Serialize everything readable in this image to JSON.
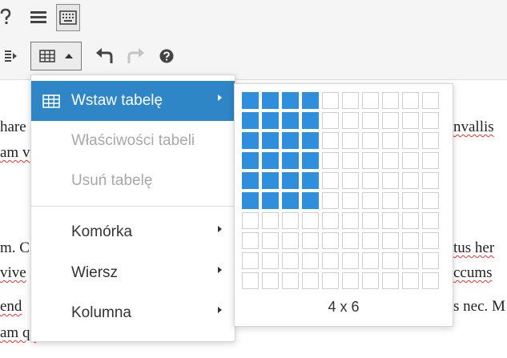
{
  "toolbar": {
    "row1": [
      {
        "name": "help-partial-icon"
      },
      {
        "name": "align-justify-icon"
      },
      {
        "name": "keyboard-icon"
      }
    ],
    "row2": [
      {
        "name": "indent-icon"
      },
      {
        "name": "table-dropdown-button"
      },
      {
        "name": "undo-icon"
      },
      {
        "name": "redo-icon"
      },
      {
        "name": "help-icon"
      }
    ]
  },
  "editor": {
    "fragments": [
      {
        "text": "hare",
        "spell": false
      },
      {
        "text": "am v",
        "spell": true
      },
      {
        "text": "nvallis",
        "spell": true
      },
      {
        "text": "m. C",
        "spell": false
      },
      {
        "text": "tus her",
        "spell": true
      },
      {
        "text": "vive",
        "spell": true
      },
      {
        "text": "ccums",
        "spell": true
      },
      {
        "text": "end",
        "spell": true
      },
      {
        "text": "s nec. M",
        "spell": false
      },
      {
        "text": "am qu",
        "spell": true
      }
    ]
  },
  "menu": {
    "items": [
      {
        "label": "Wstaw tabelę",
        "icon": "table-icon",
        "state": "active",
        "submenu": true
      },
      {
        "label": "Właściwości tabeli",
        "state": "disabled",
        "submenu": false
      },
      {
        "label": "Usuń tabelę",
        "state": "disabled",
        "submenu": false
      },
      {
        "label": "Komórka",
        "state": "normal",
        "submenu": true
      },
      {
        "label": "Wiersz",
        "state": "normal",
        "submenu": true
      },
      {
        "label": "Kolumna",
        "state": "normal",
        "submenu": true
      }
    ]
  },
  "table_grid": {
    "columns": 10,
    "rows": 10,
    "selected_columns": 4,
    "selected_rows": 6,
    "caption": "4 x 6"
  },
  "colors": {
    "accent": "#2f86c7",
    "grid_selected": "#2f8fdc",
    "disabled_text": "#a8a8a8"
  }
}
